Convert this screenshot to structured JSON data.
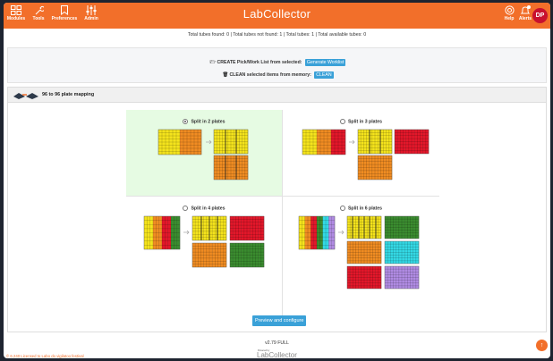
{
  "nav": {
    "modules": "Modules",
    "tools": "Tools",
    "preferences": "Preferences",
    "admin": "Admin",
    "brand": "LabCollector",
    "help": "Help",
    "alerts": "Alerts",
    "alert_count": "0",
    "avatar": "DP"
  },
  "stats": "Total tubes found: 0 | Total tubes not found: 1 | Total tubes: 1 | Total available tubes: 0",
  "create": {
    "label": "CREATE Pick/Work List from selected:",
    "button": "Generate Worklist"
  },
  "clean": {
    "label": "CLEAN selected items from memory:",
    "button": "CLEAN"
  },
  "panel": {
    "title": "96 to 96 plate mapping"
  },
  "options": [
    {
      "label": "Split in 2 plates",
      "selected": true
    },
    {
      "label": "Split in 3 plates",
      "selected": false
    },
    {
      "label": "Split in 4 plates",
      "selected": false
    },
    {
      "label": "Split in 6 plates",
      "selected": false
    }
  ],
  "preview_button": "Preview and configure",
  "footer": {
    "version": "v2.79 FULL",
    "license": "© 6.240 Licensed to Labo do vigilatoo festival",
    "powered": "Powered by",
    "logo": "LabCollector"
  },
  "colors": {
    "brand": "#f26f2a",
    "yellow": "#f4e31c",
    "orange": "#f08c22",
    "red": "#e3172a",
    "green": "#3a8c2f",
    "cyan": "#33d9e5",
    "violet": "#b08be3",
    "selected_bg": "#e6fbe3"
  }
}
